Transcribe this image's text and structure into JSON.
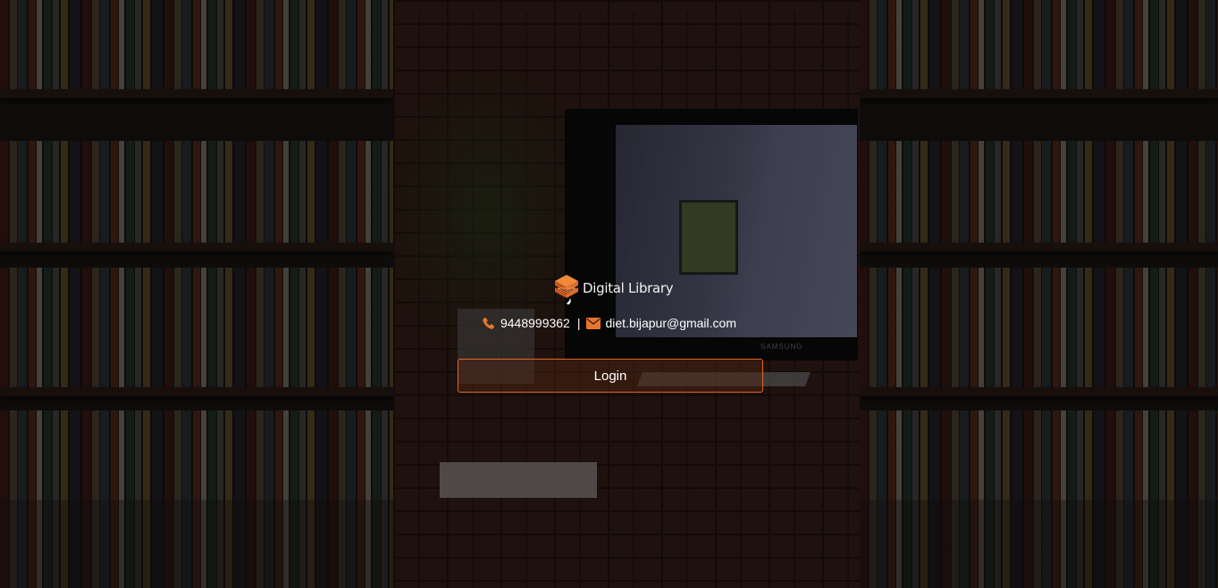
{
  "brand": {
    "logo_text": "Digital Library"
  },
  "contact": {
    "phone": "9448999362",
    "separator": "|",
    "email": "diet.bijapur@gmail.com"
  },
  "login": {
    "label": "Login"
  },
  "background": {
    "monitor_brand": "SAMSUNG"
  },
  "colors": {
    "accent": "#e8742e",
    "button_border": "#e0682a",
    "text": "#ffffff"
  },
  "icons": {
    "phone": "phone-icon",
    "email": "envelope-icon",
    "logo": "stacked-books-logo-icon"
  }
}
